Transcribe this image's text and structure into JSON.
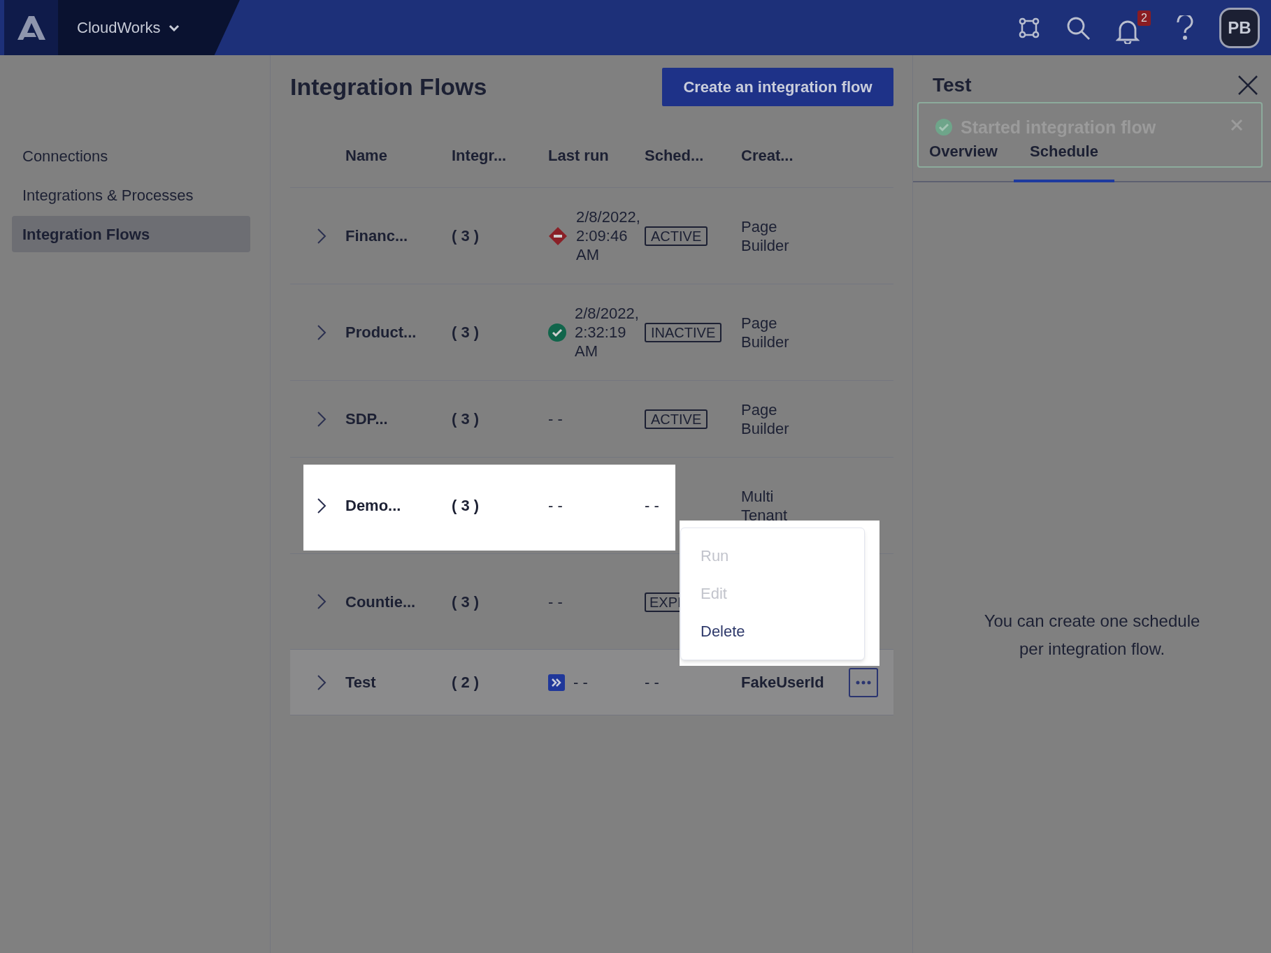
{
  "top_bar": {
    "workspace": "CloudWorks",
    "notifications": "2",
    "avatar": "PB"
  },
  "sidebar": {
    "items": [
      {
        "label": "Connections",
        "selected": false
      },
      {
        "label": "Integrations & Processes",
        "selected": false
      },
      {
        "label": "Integration Flows",
        "selected": true
      }
    ]
  },
  "main": {
    "title": "Integration Flows",
    "create_button": "Create an integration flow",
    "table": {
      "columns": [
        "Name",
        "Integr...",
        "Last run",
        "Sched...",
        "Creat..."
      ],
      "rows": [
        {
          "name": "Financ...",
          "integrations": "( 3 )",
          "last_run": {
            "kind": "error",
            "text": "2/8/2022, 2:09:46 AM"
          },
          "schedule": {
            "kind": "badge",
            "text": "ACTIVE"
          },
          "created_by": "Page Builder",
          "spotlight": false,
          "selected": false
        },
        {
          "name": "Product...",
          "integrations": "( 3 )",
          "last_run": {
            "kind": "success",
            "text": "2/8/2022, 2:32:19 AM"
          },
          "schedule": {
            "kind": "badge",
            "text": "INACTIVE"
          },
          "created_by": "Page Builder",
          "spotlight": false,
          "selected": false
        },
        {
          "name": "SDP...",
          "integrations": "( 3 )",
          "last_run": {
            "kind": "none",
            "text": "- -"
          },
          "schedule": {
            "kind": "badge",
            "text": "ACTIVE"
          },
          "created_by": "Page Builder",
          "spotlight": false,
          "selected": false
        },
        {
          "name": "Demo...",
          "integrations": "( 3 )",
          "last_run": {
            "kind": "none",
            "text": "- -"
          },
          "schedule": {
            "kind": "text",
            "text": "- -"
          },
          "created_by": "Multi Tenant",
          "spotlight": true,
          "selected": false
        },
        {
          "name": "Countie...",
          "integrations": "( 3 )",
          "last_run": {
            "kind": "none",
            "text": "- -"
          },
          "schedule": {
            "kind": "badge",
            "text": "EXPI"
          },
          "spotlight": false,
          "selected": false
        },
        {
          "name": "Test",
          "integrations": "( 2 )",
          "last_run": {
            "kind": "running",
            "text": "- -"
          },
          "schedule": {
            "kind": "text",
            "text": "- -"
          },
          "created_by": "FakeUserId",
          "more_button": true,
          "spotlight": false,
          "selected": true
        }
      ]
    },
    "context_menu": [
      {
        "label": "Run",
        "disabled": true
      },
      {
        "label": "Edit",
        "disabled": true
      },
      {
        "label": "Delete",
        "disabled": false
      }
    ]
  },
  "detail_panel": {
    "title": "Test",
    "toast": "Started integration flow",
    "tabs": [
      {
        "label": "Overview",
        "selected": false
      },
      {
        "label": "Schedule",
        "selected": true
      }
    ],
    "message": "You can create one schedule per integration flow."
  }
}
